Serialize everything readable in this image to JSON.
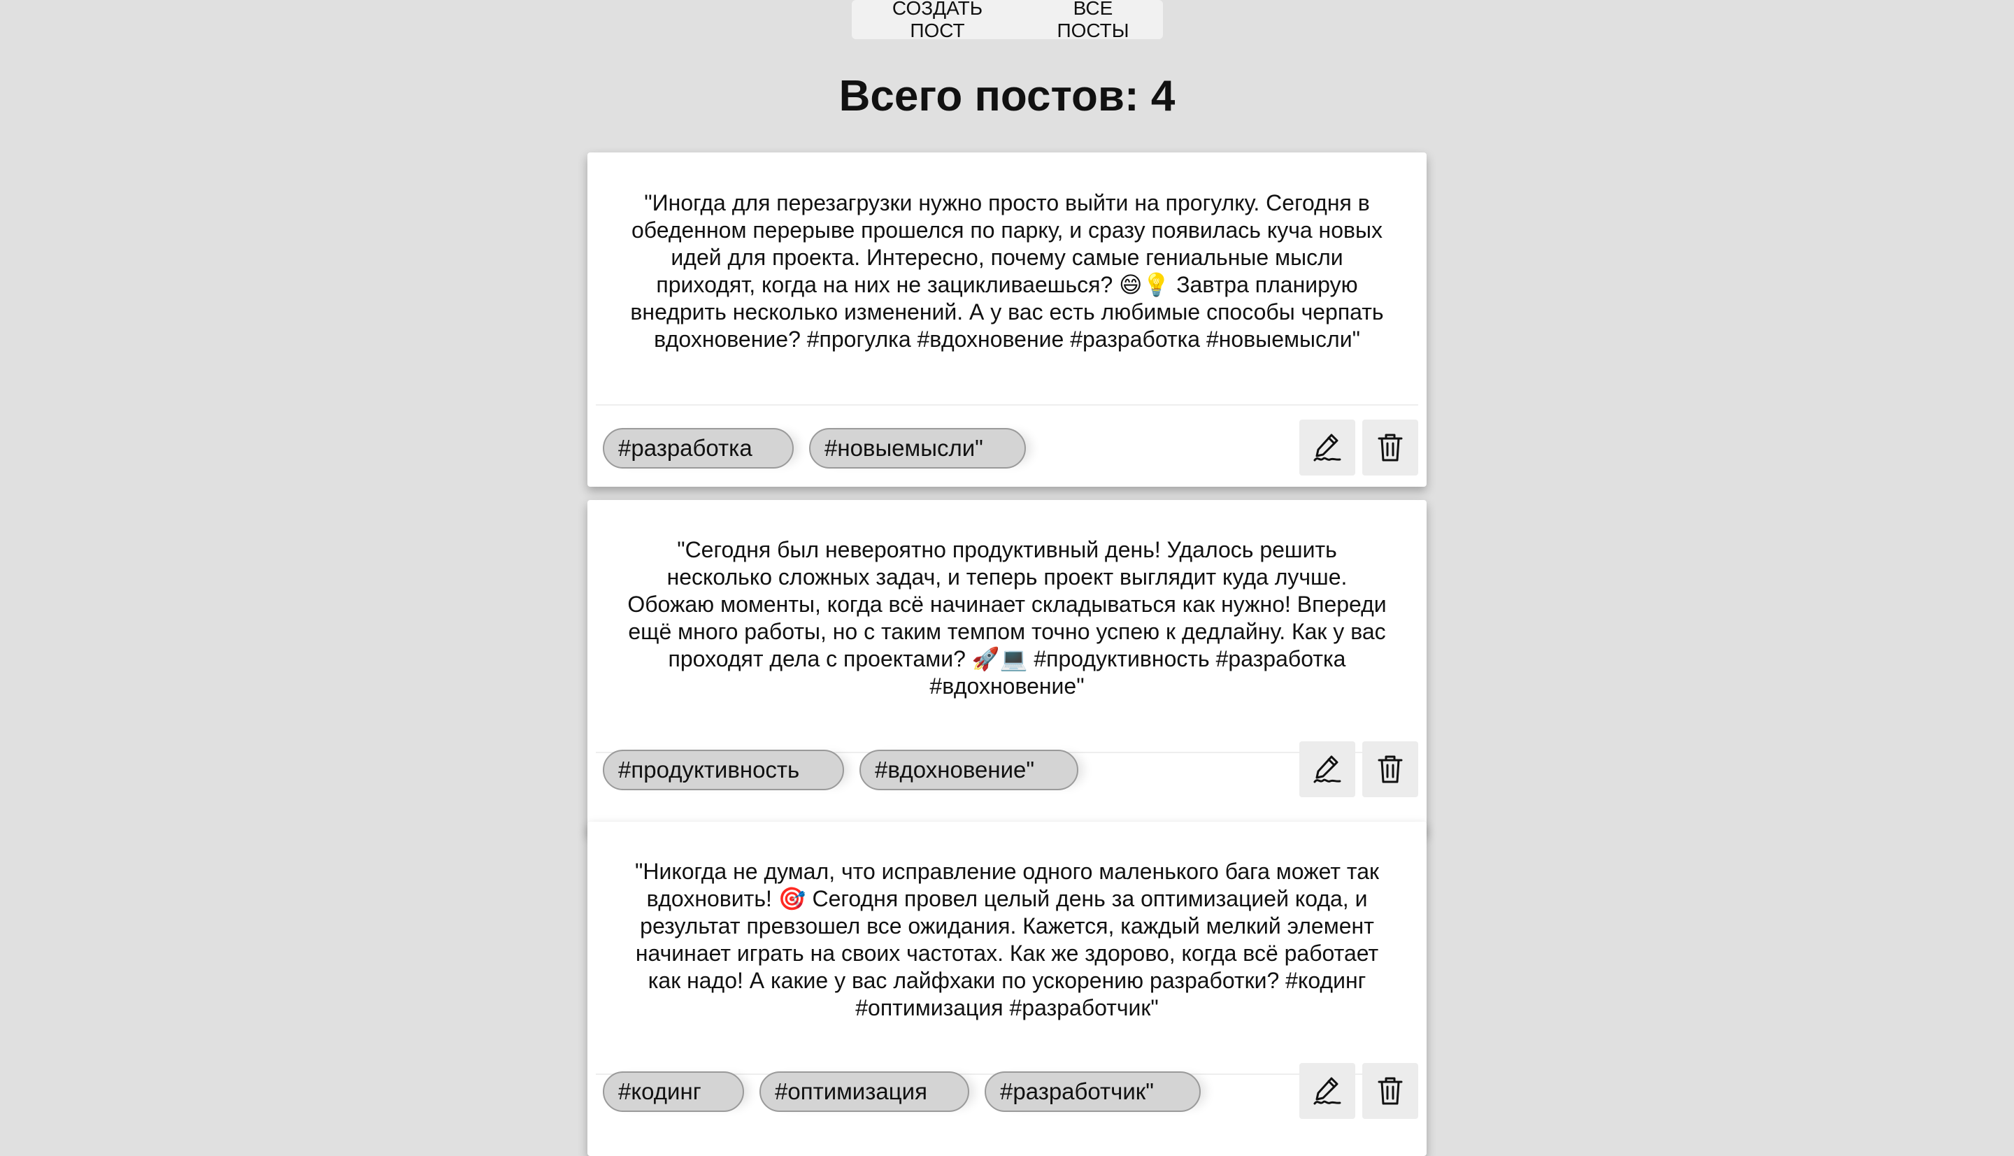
{
  "nav": {
    "create_label": "СОЗДАТЬ ПОСТ",
    "all_label": "ВСЕ ПОСТЫ"
  },
  "page": {
    "title": "Всего постов: 4"
  },
  "posts": [
    {
      "text": "\"Иногда для перезагрузки нужно просто выйти на прогулку. Сегодня в обеденном перерыве прошелся по парку, и сразу появилась куча новых идей для проекта. Интересно, почему самые гениальные мысли приходят, когда на них не зацикливаешься? 😄💡 Завтра планирую внедрить несколько изменений. А у вас есть любимые способы черпать вдохновение? #прогулка #вдохновение #разработка #новыемысли\"",
      "tags": [
        "#разработка",
        "#новыемысли\""
      ]
    },
    {
      "text": "\"Сегодня был невероятно продуктивный день! Удалось решить несколько сложных задач, и теперь проект выглядит куда лучше. Обожаю моменты, когда всё начинает складываться как нужно! Впереди ещё много работы, но с таким темпом точно успею к дедлайну. Как у вас проходят дела с проектами? 🚀💻 #продуктивность #разработка #вдохновение\"",
      "tags": [
        "#продуктивность",
        "#вдохновение\""
      ]
    },
    {
      "text": "\"Никогда не думал, что исправление одного маленького бага может так вдохновить! 🎯 Сегодня провел целый день за оптимизацией кода, и результат превзошел все ожидания. Кажется, каждый мелкий элемент начинает играть на своих частотах. Как же здорово, когда всё работает как надо! А какие у вас лайфхаки по ускорению разработки? #кодинг #оптимизация #разработчик\"",
      "tags": [
        "#кодинг",
        "#оптимизация",
        "#разработчик\""
      ]
    }
  ],
  "icons": {
    "edit": "pen-signature-icon",
    "delete": "trash-icon"
  },
  "colors": {
    "background": "#e0e0e0",
    "card": "#ffffff",
    "tag_bg": "#d4d4d4",
    "tag_border": "#9a9a9a",
    "button_bg": "#ececec"
  }
}
